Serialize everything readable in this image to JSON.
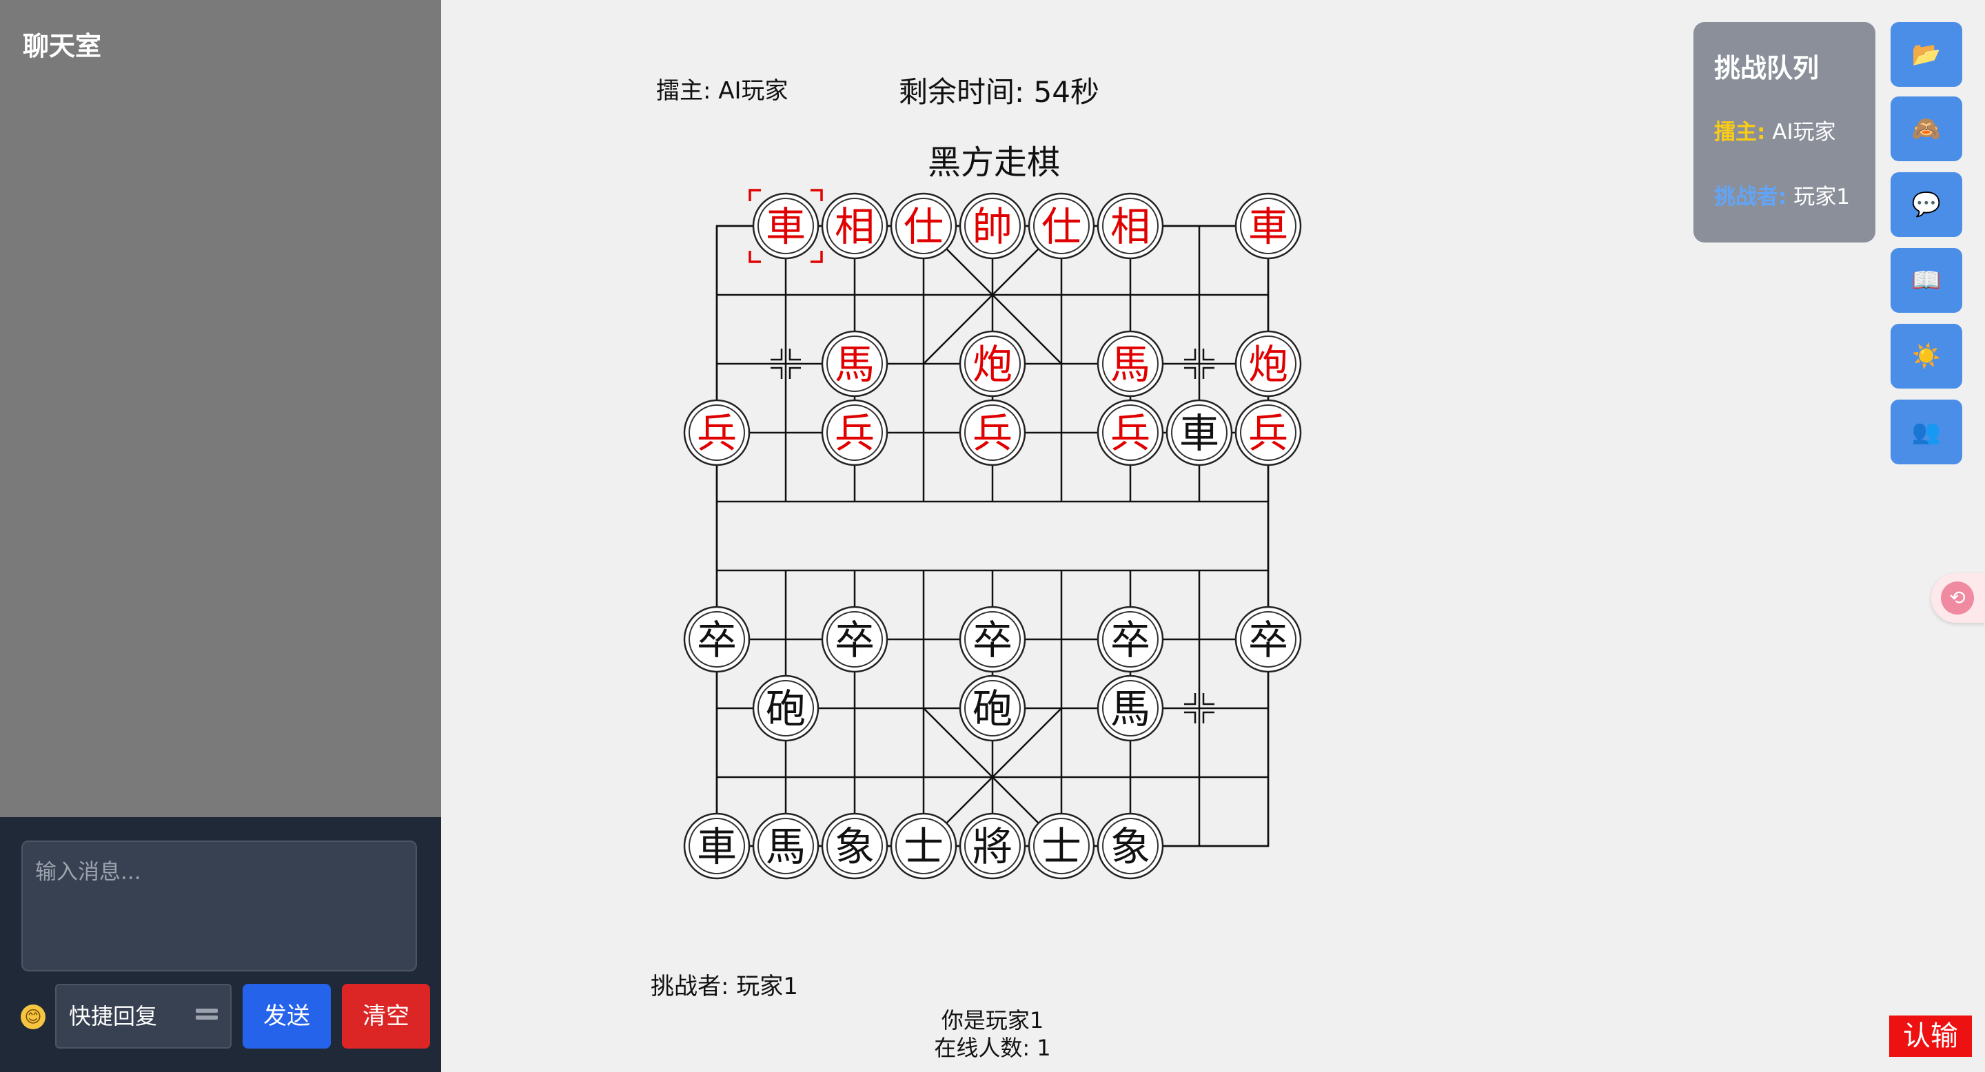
{
  "chat": {
    "title": "聊天室",
    "input_placeholder": "输入消息...",
    "emoji": "😊",
    "quick_reply": "快捷回复",
    "send_label": "发送",
    "clear_label": "清空"
  },
  "game": {
    "host_label": "擂主: AI玩家",
    "timer": "剩余时间: 54秒",
    "turn": "黑方走棋",
    "challenger_label": "挑战者: 玩家1",
    "you_are": "你是玩家1",
    "online": "在线人数: 1",
    "resign_label": "认输"
  },
  "queue": {
    "title": "挑战队列",
    "host_key": "擂主:",
    "host_name": "AI玩家",
    "challenger_key": "挑战者:",
    "challenger_name": "玩家1"
  },
  "toolbar": {
    "buttons": [
      {
        "icon": "folder-icon",
        "glyph": "📂"
      },
      {
        "icon": "monkey-icon",
        "glyph": "🙈"
      },
      {
        "icon": "speech-bubble-icon",
        "glyph": "💬"
      },
      {
        "icon": "book-icon",
        "glyph": "📖"
      },
      {
        "icon": "sun-icon",
        "glyph": "☀️"
      },
      {
        "icon": "users-icon",
        "glyph": "👥"
      }
    ],
    "translate_icon": "translate-icon"
  },
  "board": {
    "cols": 9,
    "rows": 10,
    "colors": {
      "red": "#e00000",
      "black": "#111111",
      "selected": "#e00000"
    },
    "selected": {
      "col": 1,
      "row": 0
    },
    "pieces": [
      {
        "char": "車",
        "side": "red",
        "col": 1,
        "row": 0
      },
      {
        "char": "相",
        "side": "red",
        "col": 2,
        "row": 0
      },
      {
        "char": "仕",
        "side": "red",
        "col": 3,
        "row": 0
      },
      {
        "char": "帥",
        "side": "red",
        "col": 4,
        "row": 0
      },
      {
        "char": "仕",
        "side": "red",
        "col": 5,
        "row": 0
      },
      {
        "char": "相",
        "side": "red",
        "col": 6,
        "row": 0
      },
      {
        "char": "車",
        "side": "red",
        "col": 8,
        "row": 0
      },
      {
        "char": "馬",
        "side": "red",
        "col": 2,
        "row": 2
      },
      {
        "char": "炮",
        "side": "red",
        "col": 4,
        "row": 2
      },
      {
        "char": "馬",
        "side": "red",
        "col": 6,
        "row": 2
      },
      {
        "char": "炮",
        "side": "red",
        "col": 8,
        "row": 2
      },
      {
        "char": "兵",
        "side": "red",
        "col": 0,
        "row": 3
      },
      {
        "char": "兵",
        "side": "red",
        "col": 2,
        "row": 3
      },
      {
        "char": "兵",
        "side": "red",
        "col": 4,
        "row": 3
      },
      {
        "char": "兵",
        "side": "red",
        "col": 6,
        "row": 3
      },
      {
        "char": "車",
        "side": "black",
        "col": 7,
        "row": 3
      },
      {
        "char": "兵",
        "side": "red",
        "col": 8,
        "row": 3
      },
      {
        "char": "卒",
        "side": "black",
        "col": 0,
        "row": 6
      },
      {
        "char": "卒",
        "side": "black",
        "col": 2,
        "row": 6
      },
      {
        "char": "卒",
        "side": "black",
        "col": 4,
        "row": 6
      },
      {
        "char": "卒",
        "side": "black",
        "col": 6,
        "row": 6
      },
      {
        "char": "卒",
        "side": "black",
        "col": 8,
        "row": 6
      },
      {
        "char": "砲",
        "side": "black",
        "col": 1,
        "row": 7
      },
      {
        "char": "砲",
        "side": "black",
        "col": 4,
        "row": 7
      },
      {
        "char": "馬",
        "side": "black",
        "col": 6,
        "row": 7
      },
      {
        "char": "車",
        "side": "black",
        "col": 0,
        "row": 9
      },
      {
        "char": "馬",
        "side": "black",
        "col": 1,
        "row": 9
      },
      {
        "char": "象",
        "side": "black",
        "col": 2,
        "row": 9
      },
      {
        "char": "士",
        "side": "black",
        "col": 3,
        "row": 9
      },
      {
        "char": "將",
        "side": "black",
        "col": 4,
        "row": 9
      },
      {
        "char": "士",
        "side": "black",
        "col": 5,
        "row": 9
      },
      {
        "char": "象",
        "side": "black",
        "col": 6,
        "row": 9
      }
    ],
    "markers": [
      {
        "col": 1,
        "row": 2
      },
      {
        "col": 7,
        "row": 2
      },
      {
        "col": 7,
        "row": 7
      }
    ]
  }
}
